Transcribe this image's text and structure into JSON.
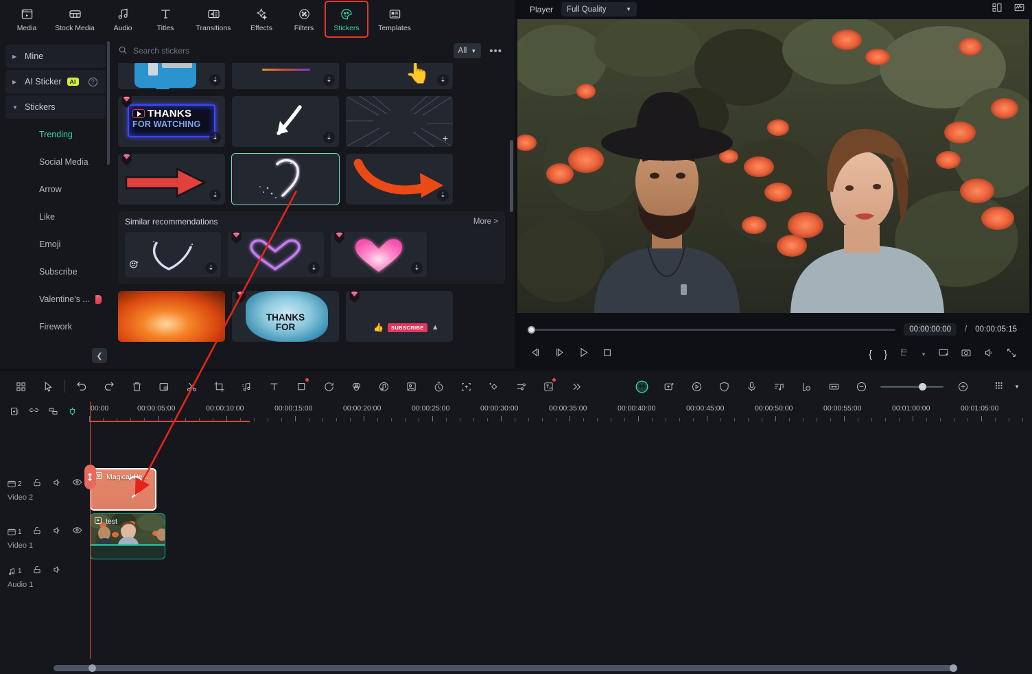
{
  "nav": {
    "tabs": [
      {
        "label": "Media",
        "icon": "media-icon"
      },
      {
        "label": "Stock Media",
        "icon": "stock-media-icon"
      },
      {
        "label": "Audio",
        "icon": "audio-icon"
      },
      {
        "label": "Titles",
        "icon": "titles-icon"
      },
      {
        "label": "Transitions",
        "icon": "transitions-icon"
      },
      {
        "label": "Effects",
        "icon": "effects-icon"
      },
      {
        "label": "Filters",
        "icon": "filters-icon"
      },
      {
        "label": "Stickers",
        "icon": "stickers-icon"
      },
      {
        "label": "Templates",
        "icon": "templates-icon"
      }
    ],
    "active": "Stickers"
  },
  "sidebar": {
    "groups": [
      {
        "label": "Mine",
        "expanded": false
      },
      {
        "label": "AI Sticker",
        "expanded": false,
        "badge": "AI",
        "help": "?"
      },
      {
        "label": "Stickers",
        "expanded": true
      }
    ],
    "items": [
      {
        "label": "Trending",
        "selected": true
      },
      {
        "label": "Social Media",
        "selected": false
      },
      {
        "label": "Arrow",
        "selected": false
      },
      {
        "label": "Like",
        "selected": false
      },
      {
        "label": "Emoji",
        "selected": false
      },
      {
        "label": "Subscribe",
        "selected": false
      },
      {
        "label": "Valentine's ...",
        "selected": false,
        "flag": true
      },
      {
        "label": "Firework",
        "selected": false
      }
    ],
    "collapse_label": "❮"
  },
  "search": {
    "placeholder": "Search stickers",
    "value": "",
    "filter_label": "All",
    "more_label": "•••"
  },
  "similar": {
    "title": "Similar recommendations",
    "more_label": "More >"
  },
  "player": {
    "title": "Player",
    "quality": "Full Quality",
    "current_time": "00:00:00:00",
    "separator": "/",
    "total_time": "00:00:05:15",
    "controls": {
      "prev_frame": "prev-frame",
      "next_frame": "next-frame",
      "play": "play",
      "stop": "stop",
      "mark_in": "{",
      "mark_out": "}",
      "snapshot": "snapshot",
      "volume": "volume",
      "fullscreen": "fullscreen"
    }
  },
  "timeline": {
    "ticks": [
      "00:00",
      "00:00:05:00",
      "00:00:10:00",
      "00:00:15:00",
      "00:00:20:00",
      "00:00:25:00",
      "00:00:30:00",
      "00:00:35:00",
      "00:00:40:00",
      "00:00:45:00",
      "00:00:50:00",
      "00:00:55:00",
      "00:01:00:00",
      "00:01:05:00"
    ],
    "tracks": [
      {
        "index": "2",
        "name": "Video 2",
        "type": "video"
      },
      {
        "index": "1",
        "name": "Video 1",
        "type": "video"
      },
      {
        "index": "1",
        "name": "Audio 1",
        "type": "audio"
      }
    ],
    "clips": [
      {
        "track": "Video 2",
        "label": "Magical He...",
        "kind": "sticker"
      },
      {
        "track": "Video 1",
        "label": "test",
        "kind": "video"
      }
    ],
    "zoom_minus": "−",
    "zoom_plus": "+"
  },
  "colors": {
    "accent": "#35d4ab",
    "highlight_box": "#e23b2e",
    "annotation": "#e8231b",
    "selected_cell": "#6fe3c0",
    "playhead": "#e0483b",
    "sticker_clip": "#e5866a"
  }
}
